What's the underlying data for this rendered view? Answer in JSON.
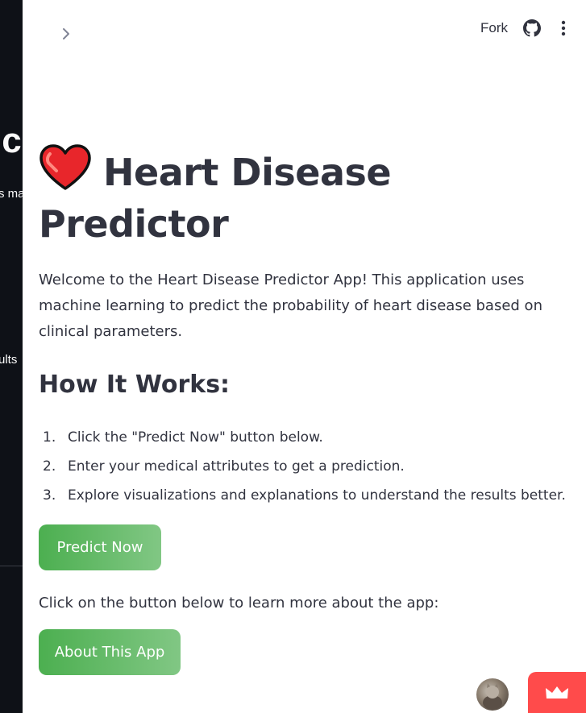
{
  "sidebar": {
    "fragment_title": "ic",
    "fragment_line1": "s ma",
    "fragment_line2": "ults"
  },
  "header": {
    "fork_label": "Fork"
  },
  "icons": {
    "expand": "chevron-right-icon",
    "github": "github-icon",
    "menu": "kebab-menu-icon",
    "heart": "heart-emoji-icon",
    "badge": "crown-icon"
  },
  "main": {
    "title": "Heart Disease Predictor",
    "intro": "Welcome to the Heart Disease Predictor App! This application uses machine learning to predict the probability of heart disease based on clinical parameters.",
    "how_heading": "How It Works:",
    "steps": [
      {
        "num": "1.",
        "text": "Click the \"Predict Now\" button below."
      },
      {
        "num": "2.",
        "text": "Enter your medical attributes to get a prediction."
      },
      {
        "num": "3.",
        "text": "Explore visualizations and explanations to understand the results better."
      }
    ],
    "predict_button": "Predict Now",
    "helper_text": "Click on the button below to learn more about the app:",
    "about_button": "About This App"
  },
  "colors": {
    "sidebar_bg": "#0e1117",
    "text": "#31333f",
    "button_green_start": "#4caf50",
    "button_green_end": "#81c784",
    "badge_red": "#ff4b4b"
  }
}
